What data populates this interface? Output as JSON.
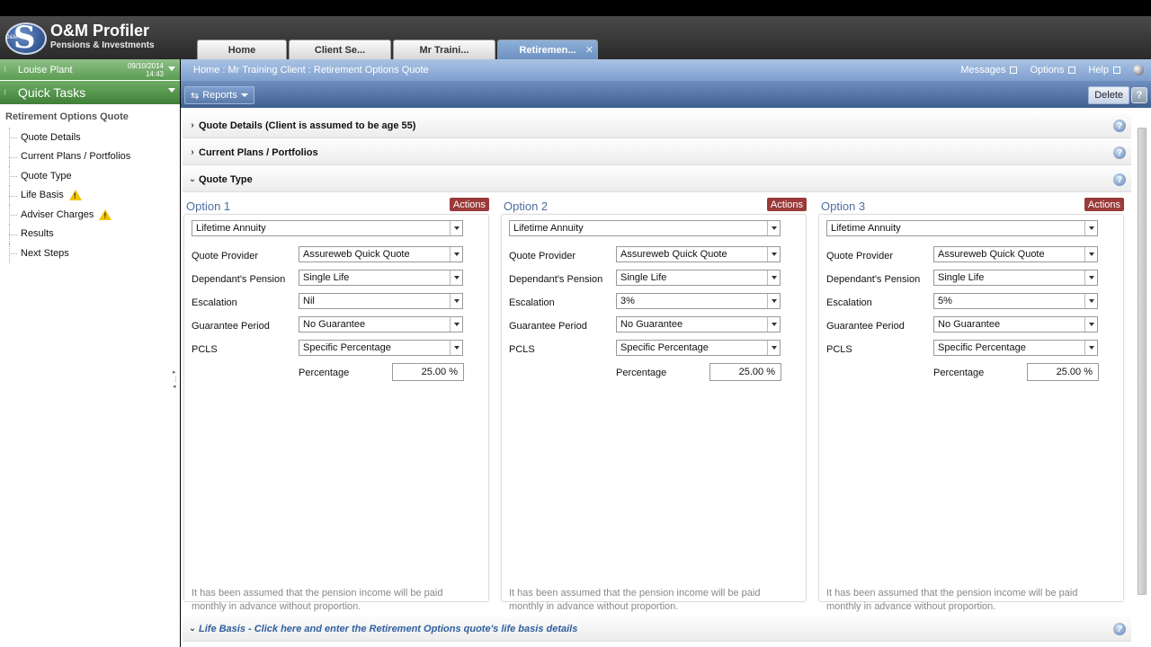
{
  "brand": {
    "title": "O&M Profiler",
    "subtitle": "Pensions & Investments",
    "logo_letter": "S",
    "logo_small": "O&M"
  },
  "tabs": [
    {
      "label": "Home"
    },
    {
      "label": "Client Se..."
    },
    {
      "label": "Mr Traini..."
    },
    {
      "label": "Retiremen...",
      "close": "✕"
    }
  ],
  "user": {
    "name": "Louise Plant",
    "date": "09/10/2014",
    "time": "14:43"
  },
  "quick_tasks": {
    "label": "Quick Tasks"
  },
  "left_nav": {
    "title": "Retirement Options Quote",
    "items": [
      {
        "label": "Quote Details"
      },
      {
        "label": "Current Plans / Portfolios"
      },
      {
        "label": "Quote Type"
      },
      {
        "label": "Life Basis",
        "warning": "!"
      },
      {
        "label": "Adviser Charges",
        "warning": "!"
      },
      {
        "label": "Results"
      },
      {
        "label": "Next Steps"
      }
    ]
  },
  "breadcrumb": "Home : Mr Training Client : Retirement Options Quote",
  "top_links": {
    "messages": "Messages",
    "options": "Options",
    "help": "Help"
  },
  "toolbar": {
    "reports": "Reports",
    "delete": "Delete",
    "help": "?"
  },
  "sections": {
    "quote_details": "Quote Details  (Client is assumed to be age 55)",
    "current_plans": "Current Plans / Portfolios",
    "quote_type": "Quote Type",
    "life_basis": "Life Basis - Click here and enter the Retirement Options quote's life basis details",
    "help_glyph": "?"
  },
  "labels": {
    "quote_provider": "Quote Provider",
    "dependants_pension": "Dependant's Pension",
    "escalation": "Escalation",
    "guarantee_period": "Guarantee Period",
    "pcls": "PCLS",
    "percentage": "Percentage",
    "actions": "Actions",
    "note": "It has been assumed that the pension income will be paid monthly in advance without proportion."
  },
  "options": [
    {
      "title": "Option 1",
      "type": "Lifetime Annuity",
      "quote_provider": "Assureweb Quick Quote",
      "dependants_pension": "Single Life",
      "escalation": "Nil",
      "guarantee_period": "No Guarantee",
      "pcls": "Specific Percentage",
      "percentage": "25.00 %"
    },
    {
      "title": "Option 2",
      "type": "Lifetime Annuity",
      "quote_provider": "Assureweb Quick Quote",
      "dependants_pension": "Single Life",
      "escalation": "3%",
      "guarantee_period": "No Guarantee",
      "pcls": "Specific Percentage",
      "percentage": "25.00 %"
    },
    {
      "title": "Option 3",
      "type": "Lifetime Annuity",
      "quote_provider": "Assureweb Quick Quote",
      "dependants_pension": "Single Life",
      "escalation": "5%",
      "guarantee_period": "No Guarantee",
      "pcls": "Specific Percentage",
      "percentage": "25.00 %"
    }
  ],
  "colors": {
    "header_blue": "#7f9fce",
    "quick_green": "#5a9c52",
    "actions_red": "#9b3a3a",
    "option_title": "#4d6e9e"
  }
}
